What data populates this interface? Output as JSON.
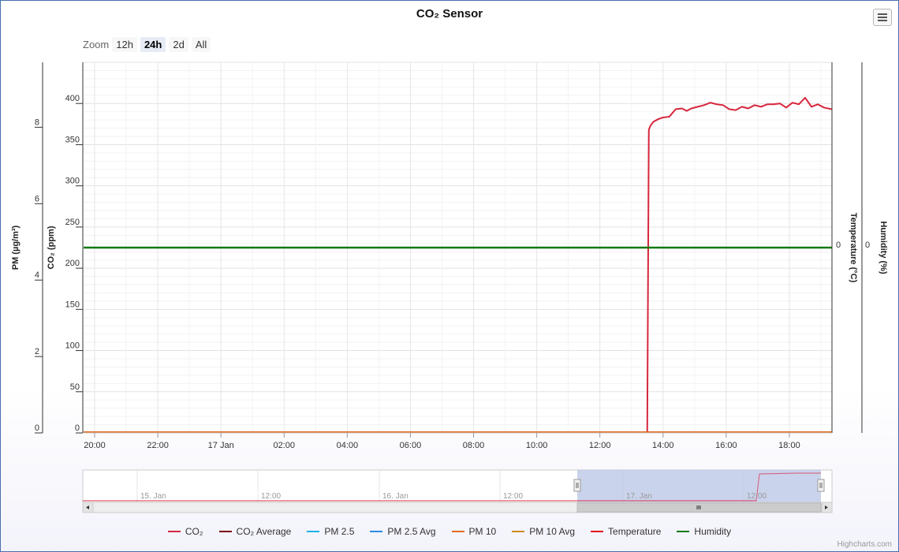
{
  "chart": {
    "title": "CO₂ Sensor",
    "credits": "Highcharts.com"
  },
  "zoom": {
    "label": "Zoom",
    "buttons": [
      "12h",
      "24h",
      "2d",
      "All"
    ],
    "active": "24h"
  },
  "axes": {
    "pm_title": "PM (µg/m³)",
    "co2_title": "CO₂ (ppm)",
    "temp_title": "Temperature (°C)",
    "hum_title": "Humidity (%)",
    "temp_tick": "0",
    "hum_tick": "0"
  },
  "navigator": {
    "labels": [
      "15. Jan",
      "12:00",
      "16. Jan",
      "12:00",
      "17. Jan",
      "12:00"
    ]
  },
  "legend": [
    {
      "name": "CO₂",
      "color": "#d7263d"
    },
    {
      "name": "CO₂ Average",
      "color": "#7b0000"
    },
    {
      "name": "PM 2.5",
      "color": "#1ab2e8"
    },
    {
      "name": "PM 2.5 Avg",
      "color": "#2a8ce6"
    },
    {
      "name": "PM 10",
      "color": "#e06a1b"
    },
    {
      "name": "PM 10 Avg",
      "color": "#d18a1a"
    },
    {
      "name": "Temperature",
      "color": "#e3121b"
    },
    {
      "name": "Humidity",
      "color": "#137a12"
    }
  ],
  "chart_data": {
    "type": "line",
    "x_ticks": [
      "20:00",
      "22:00",
      "17 Jan",
      "02:00",
      "04:00",
      "06:00",
      "08:00",
      "10:00",
      "12:00",
      "14:00",
      "16:00",
      "18:00"
    ],
    "x_tick_hours": [
      0,
      2,
      4,
      6,
      8,
      10,
      12,
      14,
      16,
      18,
      20,
      22
    ],
    "x_range_hours": [
      -0.35,
      23.35
    ],
    "co2_ticks": [
      0,
      50,
      100,
      150,
      200,
      250,
      300,
      350,
      400
    ],
    "co2_range": [
      0,
      450
    ],
    "pm_ticks": [
      0,
      2,
      4,
      6,
      8
    ],
    "pm_range": [
      0,
      9.7
    ],
    "series": [
      {
        "name": "CO₂",
        "axis": "co2",
        "x": [
          -0.35,
          17.5,
          17.55,
          17.6,
          17.7,
          17.85,
          18.0,
          18.2,
          18.4,
          18.6,
          18.75,
          18.9,
          19.1,
          19.3,
          19.5,
          19.7,
          19.9,
          20.1,
          20.3,
          20.5,
          20.7,
          20.9,
          21.1,
          21.3,
          21.5,
          21.7,
          21.9,
          22.1,
          22.3,
          22.5,
          22.7,
          22.9,
          23.1,
          23.35
        ],
        "y": [
          0,
          0,
          368,
          373,
          378,
          381,
          383,
          384,
          393,
          394,
          391,
          394,
          396,
          398,
          401,
          399,
          398,
          393,
          392,
          396,
          394,
          398,
          396,
          399,
          399,
          400,
          395,
          401,
          399,
          407,
          396,
          399,
          395,
          393
        ]
      },
      {
        "name": "Humidity",
        "axis": "hum",
        "x": [
          -0.35,
          23.35
        ],
        "y": [
          0,
          0
        ]
      },
      {
        "name": "PM 10",
        "axis": "pm",
        "x": [
          -0.35,
          23.35
        ],
        "y": [
          0,
          0
        ]
      }
    ]
  }
}
